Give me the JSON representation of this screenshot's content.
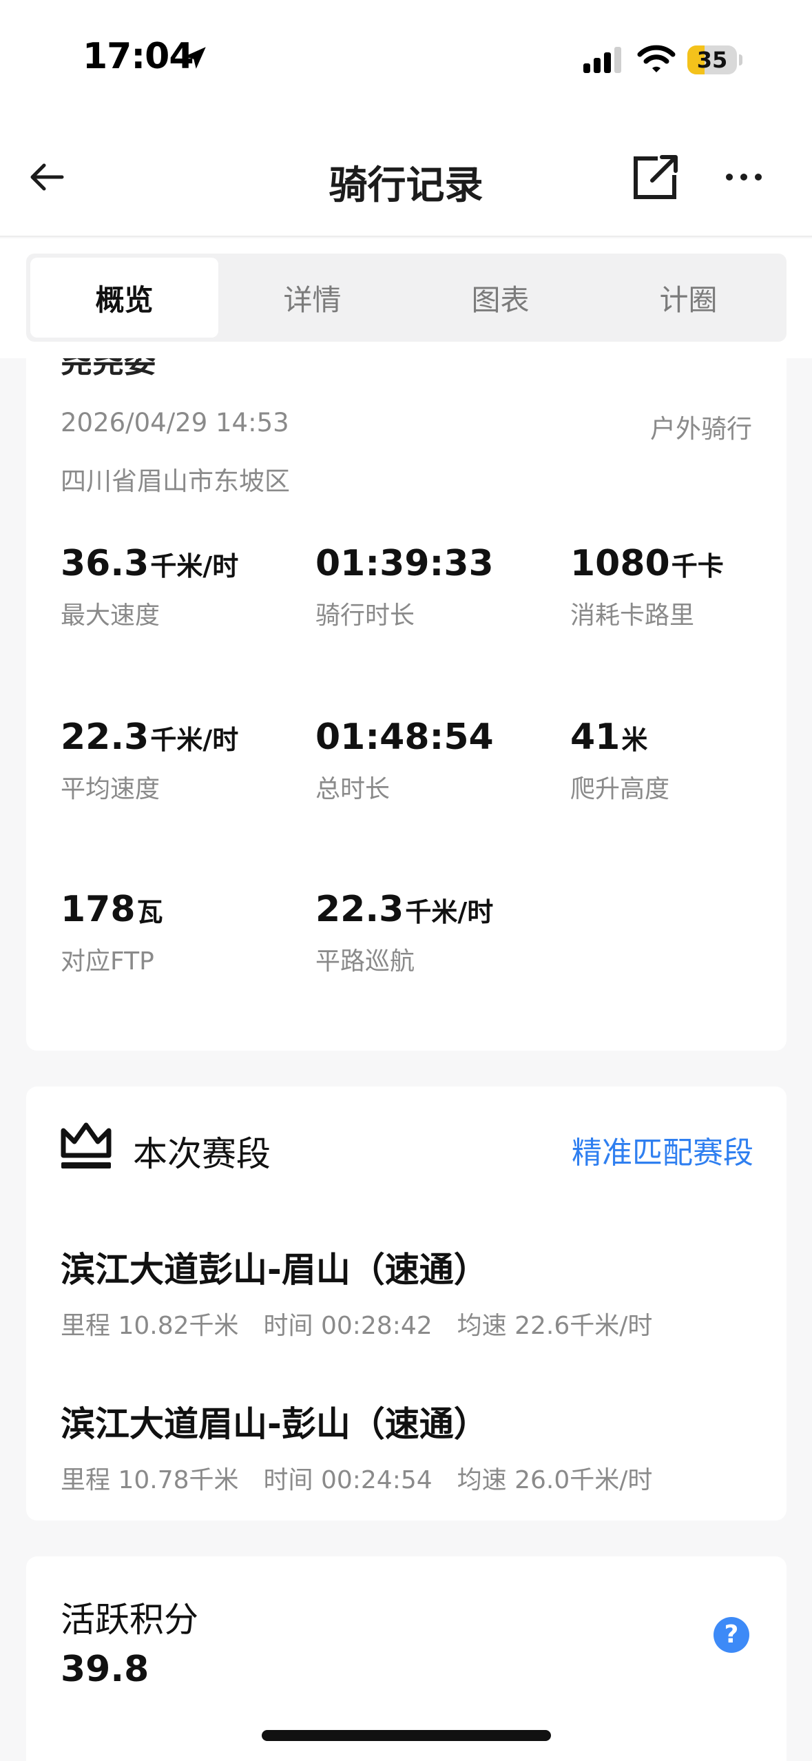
{
  "status_bar": {
    "time": "17:04",
    "battery_level": "35",
    "battery_color": "#f4c21b"
  },
  "nav": {
    "title": "骑行记录"
  },
  "tabs": [
    {
      "label": "概览",
      "active": true
    },
    {
      "label": "详情",
      "active": false
    },
    {
      "label": "图表",
      "active": false
    },
    {
      "label": "计圈",
      "active": false
    }
  ],
  "summary": {
    "route_name": "尧尧委",
    "datetime": "2026/04/29 14:53",
    "ride_type": "户外骑行",
    "location": "四川省眉山市东坡区",
    "stats": [
      {
        "value": "36.3",
        "unit": "千米/时",
        "label": "最大速度"
      },
      {
        "value": "01:39:33",
        "unit": "",
        "label": "骑行时长"
      },
      {
        "value": "1080",
        "unit": "千卡",
        "label": "消耗卡路里"
      },
      {
        "value": "22.3",
        "unit": "千米/时",
        "label": "平均速度"
      },
      {
        "value": "01:48:54",
        "unit": "",
        "label": "总时长"
      },
      {
        "value": "41",
        "unit": "米",
        "label": "爬升高度"
      },
      {
        "value": "178",
        "unit": "瓦",
        "label": "对应FTP"
      },
      {
        "value": "22.3",
        "unit": "千米/时",
        "label": "平路巡航"
      }
    ]
  },
  "segments": {
    "title": "本次赛段",
    "action": "精准匹配赛段",
    "accent_color": "#2f7ff0",
    "items": [
      {
        "name": "滨江大道彭山-眉山（速通）",
        "distance": "里程 10.82千米",
        "time": "时间 00:28:42",
        "speed": "均速 22.6千米/时"
      },
      {
        "name": "滨江大道眉山-彭山（速通）",
        "distance": "里程 10.78千米",
        "time": "时间 00:24:54",
        "speed": "均速 26.0千米/时"
      }
    ]
  },
  "points": {
    "title": "活跃积分",
    "value": "39.8",
    "help_icon": "?"
  }
}
